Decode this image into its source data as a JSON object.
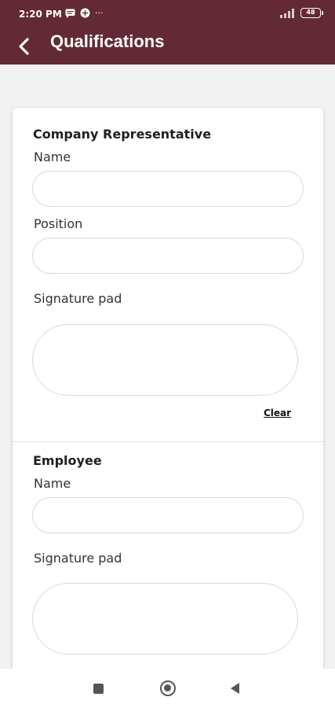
{
  "status_bar": {
    "time": "2:20 PM",
    "dots": "···",
    "battery": "48",
    "icons": [
      "message-icon",
      "game-icon",
      "signal-icon",
      "battery-icon"
    ]
  },
  "header": {
    "title": "Qualifications",
    "background_color": "#632a35"
  },
  "company_representative": {
    "title": "Company Representative",
    "name_label": "Name",
    "name_value": "",
    "position_label": "Position",
    "position_value": "",
    "signature_label": "Signature pad",
    "clear_label": "Clear"
  },
  "employee": {
    "title": "Employee",
    "name_label": "Name",
    "name_value": "",
    "signature_label": "Signature pad"
  }
}
